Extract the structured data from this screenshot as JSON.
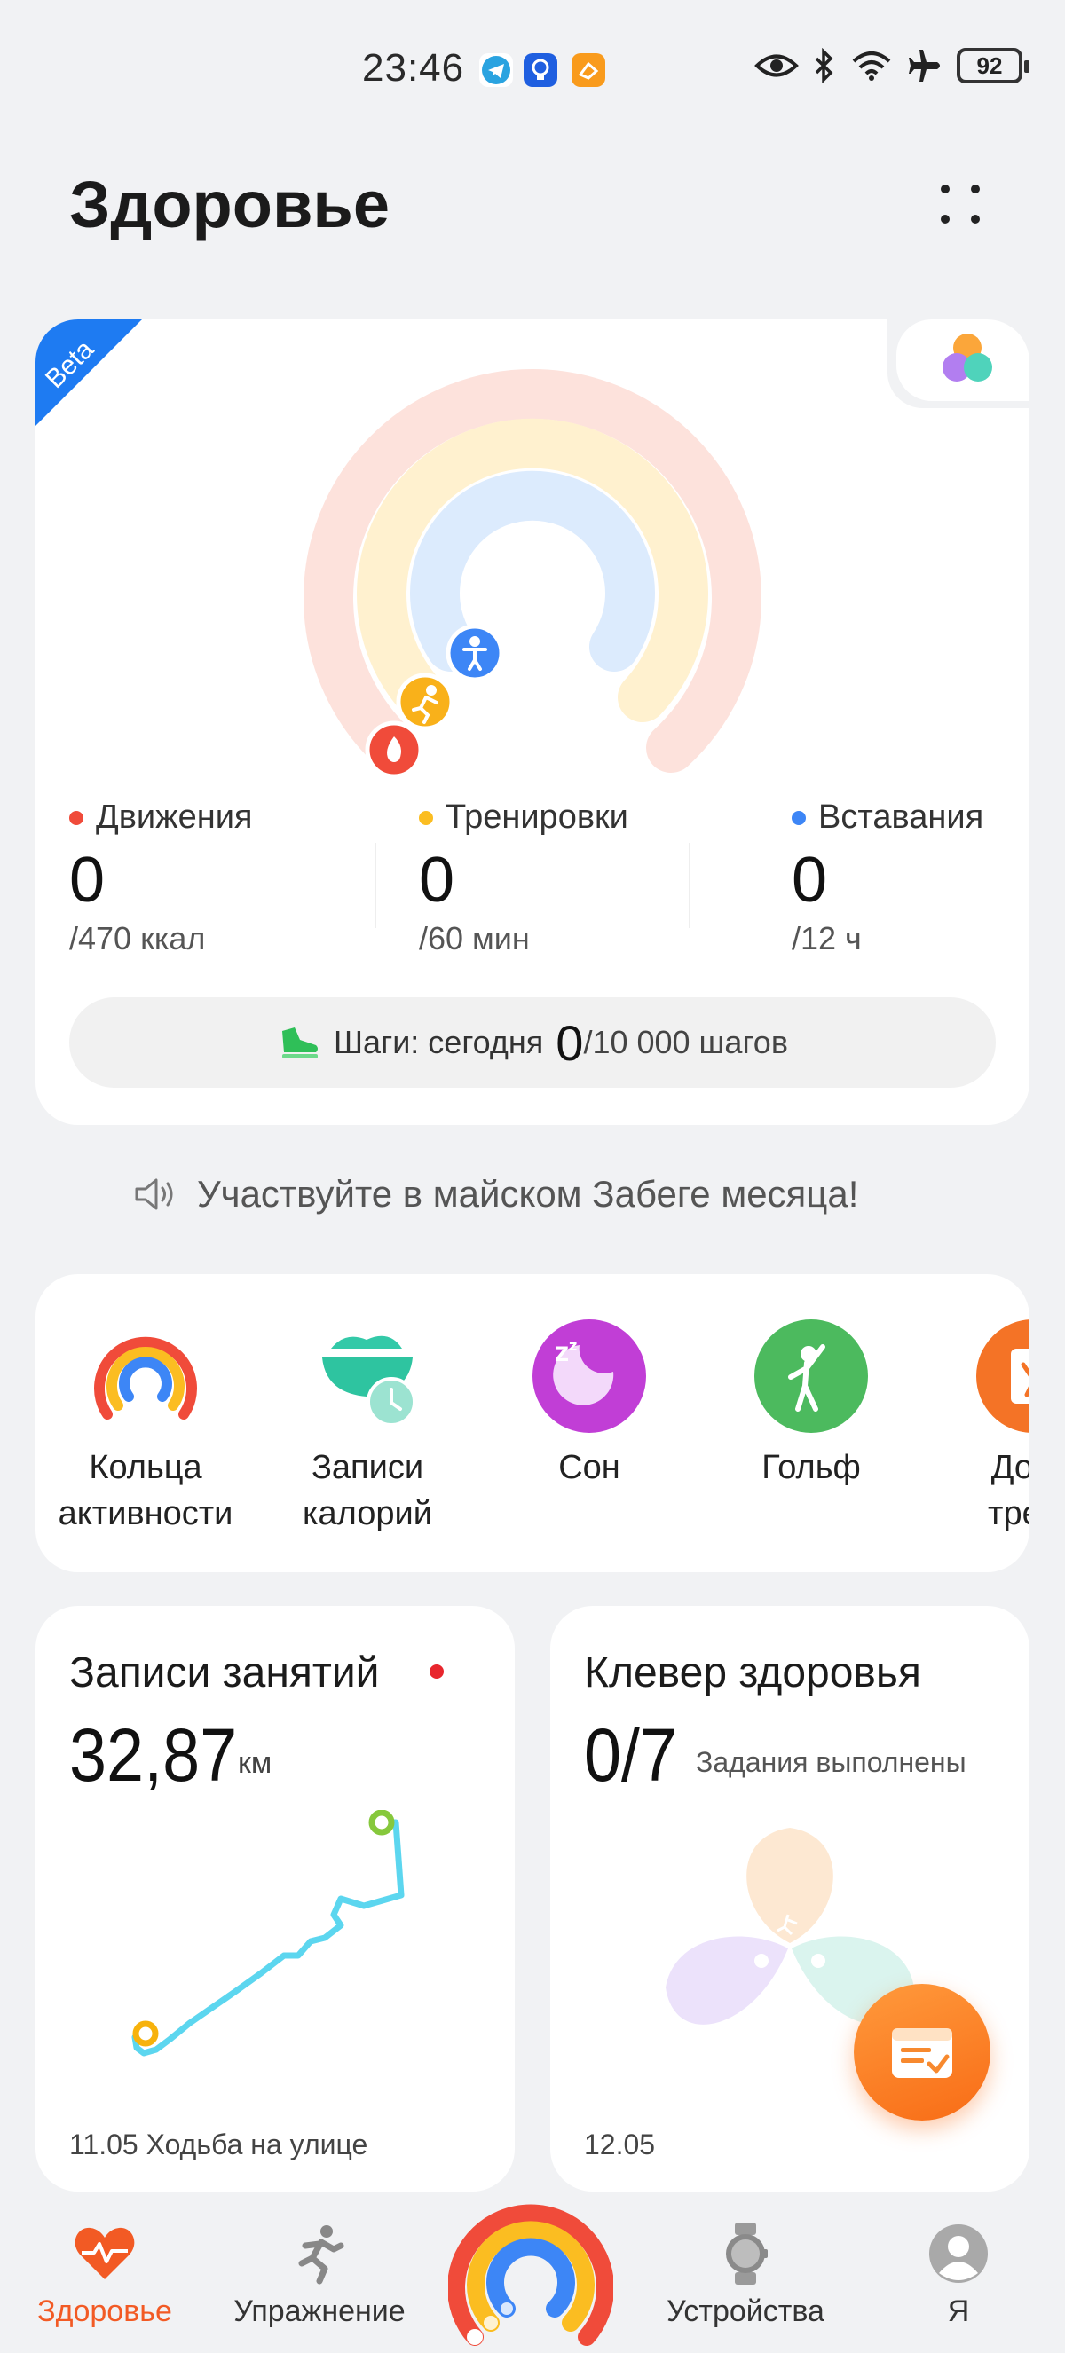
{
  "status_bar": {
    "time": "23:46",
    "notification_icons": [
      "telegram-icon",
      "bulb-app-icon",
      "orange-app-icon"
    ],
    "system_icons": [
      "eye-icon",
      "bluetooth-icon",
      "wifi-icon",
      "airplane-icon"
    ],
    "battery": "92"
  },
  "header": {
    "title": "Здоровье",
    "more_icon": "more-dots-icon"
  },
  "activity": {
    "beta_label": "Beta",
    "metrics": [
      {
        "label": "Движения",
        "value": "0",
        "goal": "/470 ккал",
        "color": "#f04b3a"
      },
      {
        "label": "Тренировки",
        "value": "0",
        "goal": "/60 мин",
        "color": "#fbbd21"
      },
      {
        "label": "Вставания",
        "value": "0",
        "goal": "/12 ч",
        "color": "#3d86f6"
      }
    ],
    "steps": {
      "label": "Шаги: сегодня",
      "value": "0",
      "goal": "/10 000 шагов"
    }
  },
  "announcement": {
    "text": "Участвуйте в майском Забеге месяца!",
    "icon": "speaker-icon"
  },
  "shortcuts": [
    {
      "label": "Кольца\nактивности",
      "icon": "activity-rings-icon"
    },
    {
      "label": "Записи\nкалорий",
      "icon": "calorie-bowl-icon"
    },
    {
      "label": "Сон",
      "icon": "sleep-moon-icon"
    },
    {
      "label": "Гольф",
      "icon": "golf-icon"
    },
    {
      "label": "Дома\nтрени",
      "icon": "home-workout-icon"
    }
  ],
  "records_card": {
    "title": "Записи занятий",
    "distance": "32,87",
    "unit": "км",
    "date": "11.05",
    "activity": "Ходьба на улице"
  },
  "clover_card": {
    "title": "Клевер здоровья",
    "progress": "0/7",
    "subtitle": "Задания выполнены",
    "date": "12.05"
  },
  "bottom_nav": [
    {
      "label": "Здоровье",
      "icon": "heart-pulse-icon",
      "active": true
    },
    {
      "label": "Упражнение",
      "icon": "running-icon",
      "active": false
    },
    {
      "label": "",
      "icon": "activity-rings-icon",
      "active": false
    },
    {
      "label": "Устройства",
      "icon": "watch-icon",
      "active": false
    },
    {
      "label": "Я",
      "icon": "profile-icon",
      "active": false
    }
  ],
  "colors": {
    "accent": "#f25a24",
    "move": "#f04b3a",
    "exercise": "#fbbd21",
    "stand": "#3d86f6",
    "beta": "#1e7bf2"
  }
}
